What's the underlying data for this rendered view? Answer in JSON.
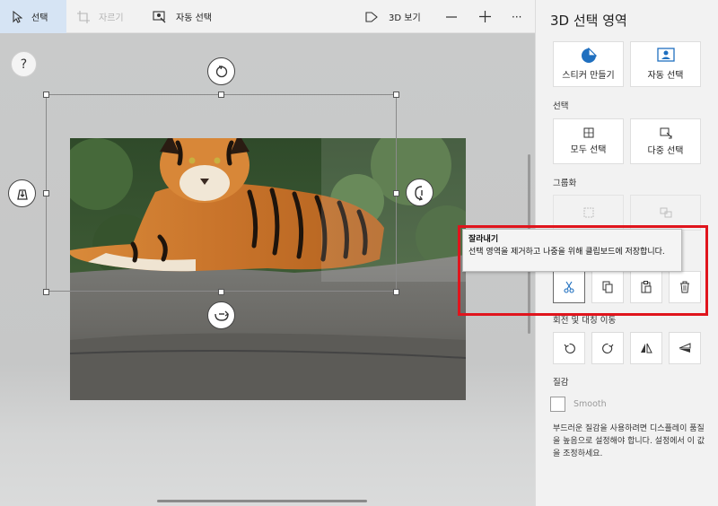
{
  "toolbar": {
    "select_label": "선택",
    "crop_label": "자르기",
    "magic_select_label": "자동 선택",
    "view3d_label": "3D 보기",
    "minus_label": "—",
    "plus_label": "+",
    "more_label": "···"
  },
  "canvas": {
    "help_label": "?"
  },
  "panel": {
    "title": "3D 선택 영역",
    "top_buttons": [
      {
        "label": "스티커 만들기",
        "icon": "sticker-icon"
      },
      {
        "label": "자동 선택",
        "icon": "magic-select-icon"
      }
    ],
    "sections": {
      "select": "선택",
      "group": "그룹화",
      "rotate": "회전 및 대칭 이동",
      "texture": "질감"
    },
    "select_buttons": [
      {
        "label": "모두 선택",
        "icon": "select-all-icon"
      },
      {
        "label": "다중 선택",
        "icon": "multi-select-icon"
      }
    ],
    "smooth_label": "Smooth",
    "description": "부드러운 질감을 사용하려면 디스플레이 품질을 높음으로 설정해야 합니다. 설정에서 이 값을 조정하세요."
  },
  "tooltip": {
    "title": "잘라내기",
    "body": "선택 영역을 제거하고 나중을 위해 클립보드에 저장합니다."
  },
  "colors": {
    "accent": "#1f6fbf",
    "highlight": "#e0151d",
    "active_tool_bg": "#d6e4f4"
  }
}
